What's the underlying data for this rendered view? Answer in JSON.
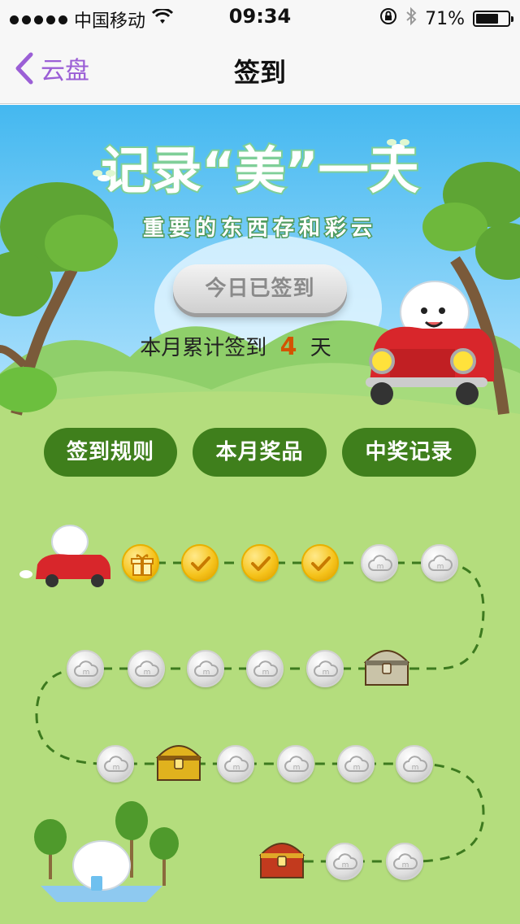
{
  "status_bar": {
    "carrier": "中国移动",
    "time": "09:34",
    "battery": "71%",
    "battery_level": 0.71,
    "icons": [
      "signal-dots-icon",
      "wifi-icon",
      "orientation-lock-icon",
      "bluetooth-icon",
      "battery-icon"
    ]
  },
  "nav": {
    "back_label": "云盘",
    "title": "签到",
    "accent_color": "#9b5fd6"
  },
  "banner": {
    "headline": "记录“美”一天",
    "subtitle": "重要的东西存和彩云"
  },
  "checkin": {
    "button_label": "今日已签到",
    "summary_prefix": "本月累计签到",
    "days": "4",
    "summary_suffix": "天"
  },
  "tabs": [
    {
      "label": "签到规则"
    },
    {
      "label": "本月奖品"
    },
    {
      "label": "中奖记录"
    }
  ],
  "path": {
    "signed_days": 4,
    "nodes": [
      {
        "type": "gift"
      },
      {
        "type": "checked"
      },
      {
        "type": "checked"
      },
      {
        "type": "checked"
      },
      {
        "type": "pending"
      },
      {
        "type": "pending"
      },
      {
        "type": "silver-chest"
      },
      {
        "type": "pending"
      },
      {
        "type": "pending"
      },
      {
        "type": "pending"
      },
      {
        "type": "pending"
      },
      {
        "type": "pending"
      },
      {
        "type": "pending"
      },
      {
        "type": "gold-chest"
      },
      {
        "type": "pending"
      },
      {
        "type": "pending"
      },
      {
        "type": "pending"
      },
      {
        "type": "pending"
      },
      {
        "type": "pending"
      },
      {
        "type": "pending"
      },
      {
        "type": "red-chest"
      }
    ]
  }
}
